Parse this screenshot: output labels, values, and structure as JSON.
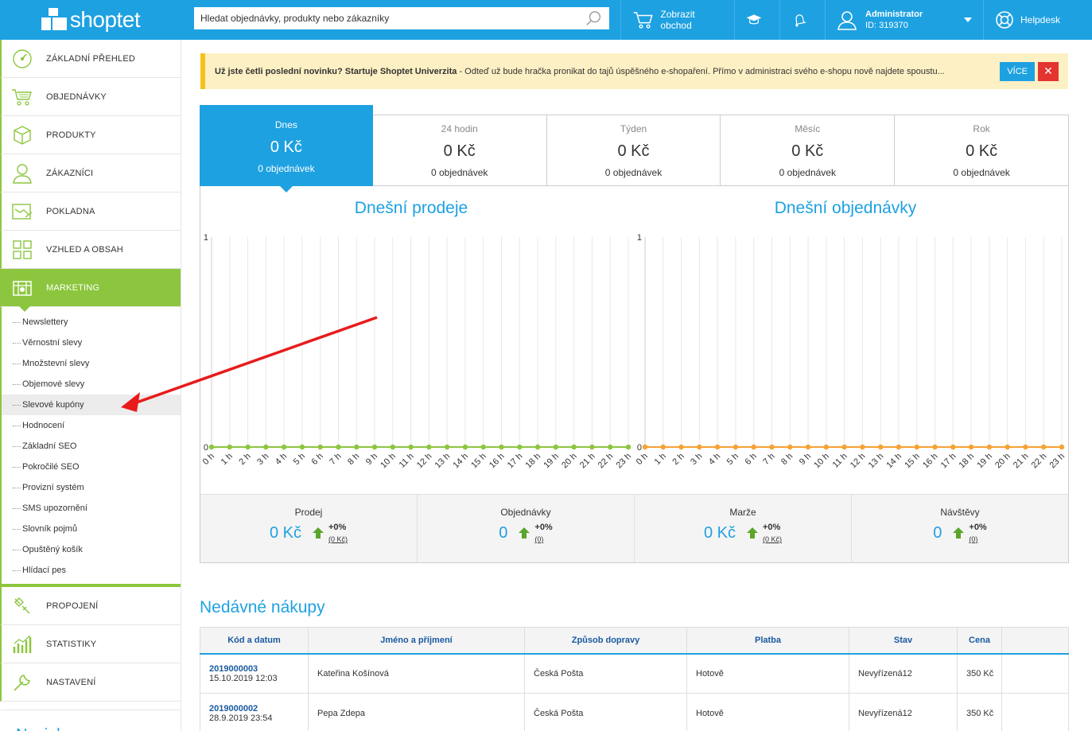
{
  "brand": {
    "name": "shoptet"
  },
  "search": {
    "placeholder": "Hledat objednávky, produkty nebo zákazníky"
  },
  "topbar": {
    "show_shop": "Zobrazit obchod",
    "admin_name": "Administrator",
    "admin_id": "ID: 319370",
    "helpdesk": "Helpdesk"
  },
  "sidebar": {
    "items": [
      {
        "label": "ZÁKLADNÍ PŘEHLED",
        "icon": "dashboard-icon"
      },
      {
        "label": "OBJEDNÁVKY",
        "icon": "cart-icon"
      },
      {
        "label": "PRODUKTY",
        "icon": "box-icon"
      },
      {
        "label": "ZÁKAZNÍCI",
        "icon": "user-icon"
      },
      {
        "label": "POKLADNA",
        "icon": "register-icon"
      },
      {
        "label": "VZHLED A OBSAH",
        "icon": "layout-icon"
      },
      {
        "label": "MARKETING",
        "icon": "marketing-icon"
      }
    ],
    "marketing_sub": [
      "Newslettery",
      "Věrnostní slevy",
      "Množstevní slevy",
      "Objemové slevy",
      "Slevové kupóny",
      "Hodnocení",
      "Základní SEO",
      "Pokročilé SEO",
      "Provizní systém",
      "SMS upozornění",
      "Slovník pojmů",
      "Opuštěný košík",
      "Hlídací pes"
    ],
    "items_after": [
      {
        "label": "PROPOJENÍ",
        "icon": "plug-icon"
      },
      {
        "label": "STATISTIKY",
        "icon": "stats-icon"
      },
      {
        "label": "NASTAVENÍ",
        "icon": "wrench-icon"
      }
    ],
    "novinky": "Novinky"
  },
  "banner": {
    "bold": "Už jste četli poslední novinku? Startuje Shoptet Univerzita",
    "text": " - Odteď už bude hračka pronikat do tajů úspěšného e-shopaření. Přímo v administraci svého e-shopu nově najdete spoustu...",
    "more": "VÍCE",
    "close": "✕"
  },
  "tabs": [
    {
      "title": "Dnes",
      "value": "0 Kč",
      "orders": "0 objednávek",
      "active": true
    },
    {
      "title": "24 hodin",
      "value": "0 Kč",
      "orders": "0 objednávek"
    },
    {
      "title": "Týden",
      "value": "0 Kč",
      "orders": "0 objednávek"
    },
    {
      "title": "Měsíc",
      "value": "0 Kč",
      "orders": "0 objednávek"
    },
    {
      "title": "Rok",
      "value": "0 Kč",
      "orders": "0 objednávek"
    }
  ],
  "charts": {
    "sales_title": "Dnešní prodeje",
    "orders_title": "Dnešní objednávky",
    "sales_color": "#8cc63f",
    "orders_color": "#f7a234"
  },
  "chart_data": [
    {
      "type": "line",
      "title": "Dnešní prodeje",
      "categories": [
        "0 h",
        "1 h",
        "2 h",
        "3 h",
        "4 h",
        "5 h",
        "6 h",
        "7 h",
        "8 h",
        "9 h",
        "10 h",
        "11 h",
        "12 h",
        "13 h",
        "14 h",
        "15 h",
        "16 h",
        "17 h",
        "18 h",
        "19 h",
        "20 h",
        "21 h",
        "22 h",
        "23 h"
      ],
      "values": [
        0,
        0,
        0,
        0,
        0,
        0,
        0,
        0,
        0,
        0,
        0,
        0,
        0,
        0,
        0,
        0,
        0,
        0,
        0,
        0,
        0,
        0,
        0,
        0
      ],
      "ylim": [
        0,
        1
      ],
      "yticks": [
        "0",
        "1"
      ]
    },
    {
      "type": "line",
      "title": "Dnešní objednávky",
      "categories": [
        "0 h",
        "1 h",
        "2 h",
        "3 h",
        "4 h",
        "5 h",
        "6 h",
        "7 h",
        "8 h",
        "9 h",
        "10 h",
        "11 h",
        "12 h",
        "13 h",
        "14 h",
        "15 h",
        "16 h",
        "17 h",
        "18 h",
        "19 h",
        "20 h",
        "21 h",
        "22 h",
        "23 h"
      ],
      "values": [
        0,
        0,
        0,
        0,
        0,
        0,
        0,
        0,
        0,
        0,
        0,
        0,
        0,
        0,
        0,
        0,
        0,
        0,
        0,
        0,
        0,
        0,
        0,
        0
      ],
      "ylim": [
        0,
        1
      ],
      "yticks": [
        "0",
        "1"
      ]
    }
  ],
  "summary": [
    {
      "label": "Prodej",
      "value": "0 Kč",
      "pct": "+0%",
      "prev": "(0 Kč)"
    },
    {
      "label": "Objednávky",
      "value": "0",
      "pct": "+0%",
      "prev": "(0)"
    },
    {
      "label": "Marže",
      "value": "0 Kč",
      "pct": "+0%",
      "prev": "(0 Kč)"
    },
    {
      "label": "Návštěvy",
      "value": "0",
      "pct": "+0%",
      "prev": "(0)"
    }
  ],
  "recent": {
    "title": "Nedávné nákupy",
    "headers": [
      "Kód a datum",
      "Jméno a příjmení",
      "Způsob dopravy",
      "Platba",
      "Stav",
      "Cena",
      ""
    ],
    "rows": [
      {
        "code": "2019000003",
        "date": "15.10.2019 12:03",
        "name": "Kateřina Košínová",
        "shipping": "Česká Pošta",
        "payment": "Hotově",
        "status": "Nevyřízená12",
        "price": "350 Kč"
      },
      {
        "code": "2019000002",
        "date": "28.9.2019 23:54",
        "name": "Pepa Zdepa",
        "shipping": "Česká Pošta",
        "payment": "Hotově",
        "status": "Nevyřízená12",
        "price": "350 Kč"
      }
    ]
  }
}
